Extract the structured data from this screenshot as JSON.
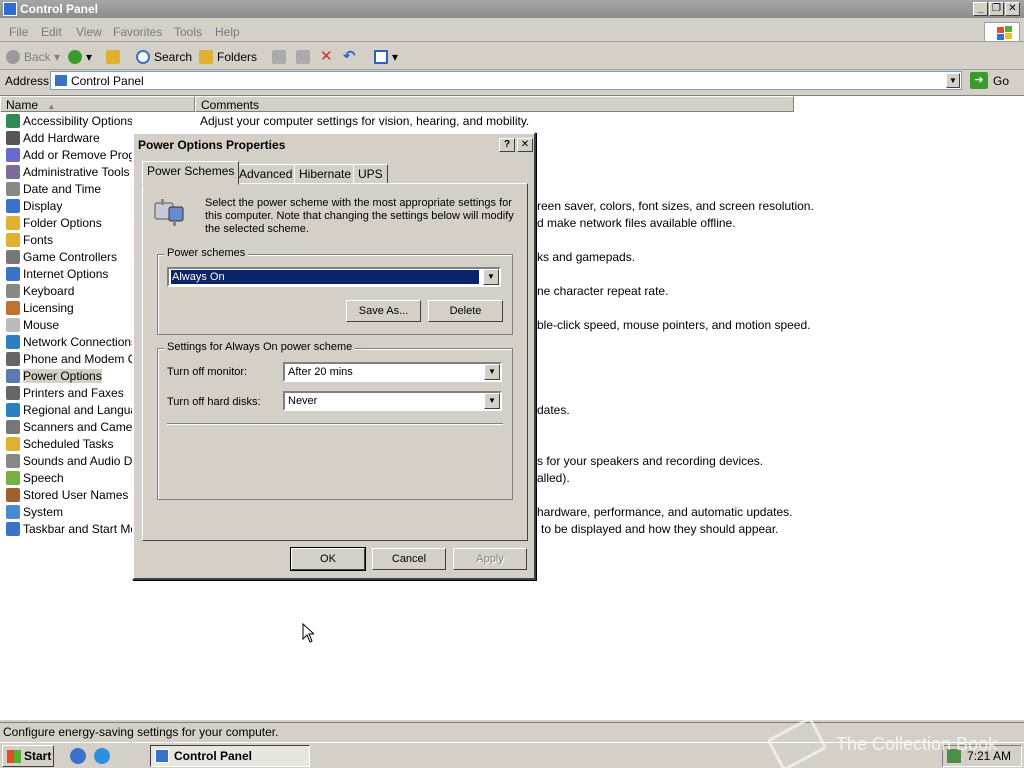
{
  "window": {
    "title": "Control Panel"
  },
  "menu": [
    "File",
    "Edit",
    "View",
    "Favorites",
    "Tools",
    "Help"
  ],
  "toolbar": {
    "back": "Back",
    "search": "Search",
    "folders": "Folders"
  },
  "address": {
    "label": "Address",
    "value": "Control Panel",
    "go": "Go"
  },
  "columns": {
    "name": "Name",
    "comments": "Comments"
  },
  "items": [
    {
      "name": "Accessibility Options",
      "color": "#2e8b57"
    },
    {
      "name": "Add Hardware",
      "color": "#555"
    },
    {
      "name": "Add or Remove Programs",
      "color": "#6a6acd"
    },
    {
      "name": "Administrative Tools",
      "color": "#7b6a9c"
    },
    {
      "name": "Date and Time",
      "color": "#888"
    },
    {
      "name": "Display",
      "color": "#3a72c9"
    },
    {
      "name": "Folder Options",
      "color": "#e0b030"
    },
    {
      "name": "Fonts",
      "color": "#e0b030"
    },
    {
      "name": "Game Controllers",
      "color": "#777"
    },
    {
      "name": "Internet Options",
      "color": "#3a72c9"
    },
    {
      "name": "Keyboard",
      "color": "#888"
    },
    {
      "name": "Licensing",
      "color": "#c07030"
    },
    {
      "name": "Mouse",
      "color": "#bbb"
    },
    {
      "name": "Network Connections",
      "color": "#2a80c0"
    },
    {
      "name": "Phone and Modem Options",
      "color": "#666"
    },
    {
      "name": "Power Options",
      "color": "#5a7ab0"
    },
    {
      "name": "Printers and Faxes",
      "color": "#666"
    },
    {
      "name": "Regional and Language Options",
      "color": "#2a80c0"
    },
    {
      "name": "Scanners and Cameras",
      "color": "#777"
    },
    {
      "name": "Scheduled Tasks",
      "color": "#e0b030"
    },
    {
      "name": "Sounds and Audio Devices",
      "color": "#888"
    },
    {
      "name": "Speech",
      "color": "#7ab040"
    },
    {
      "name": "Stored User Names and Passwords",
      "color": "#a06030"
    },
    {
      "name": "System",
      "color": "#4a8ad0"
    },
    {
      "name": "Taskbar and Start Menu",
      "color": "#3a72c9"
    }
  ],
  "comments": [
    "Adjust your computer settings for vision, hearing, and mobility.",
    "reen saver, colors, font sizes, and screen resolution.",
    "d make network files available offline.",
    "ks and gamepads.",
    "ne character repeat rate.",
    "ble-click speed, mouse pointers, and motion speed.",
    "dates.",
    "s for your speakers and recording devices.",
    "alled).",
    "hardware, performance, and automatic updates.",
    "to be displayed and how they should appear."
  ],
  "status": "Configure energy-saving settings for your computer.",
  "taskbar": {
    "start": "Start",
    "task": "Control Panel",
    "clock": "7:21 AM"
  },
  "watermark": "The Collection Book",
  "dialog": {
    "title": "Power Options Properties",
    "help": "?",
    "close": "✕",
    "tabs": [
      "Power Schemes",
      "Advanced",
      "Hibernate",
      "UPS"
    ],
    "description": "Select the power scheme with the most appropriate settings for this computer. Note that changing the settings below will modify the selected scheme.",
    "schemes_group": "Power schemes",
    "scheme_value": "Always On",
    "save_as": "Save As...",
    "delete": "Delete",
    "settings_group": "Settings for Always On power scheme",
    "monitor_label": "Turn off monitor:",
    "monitor_value": "After 20 mins",
    "disks_label": "Turn off hard disks:",
    "disks_value": "Never",
    "ok": "OK",
    "cancel": "Cancel",
    "apply": "Apply"
  }
}
